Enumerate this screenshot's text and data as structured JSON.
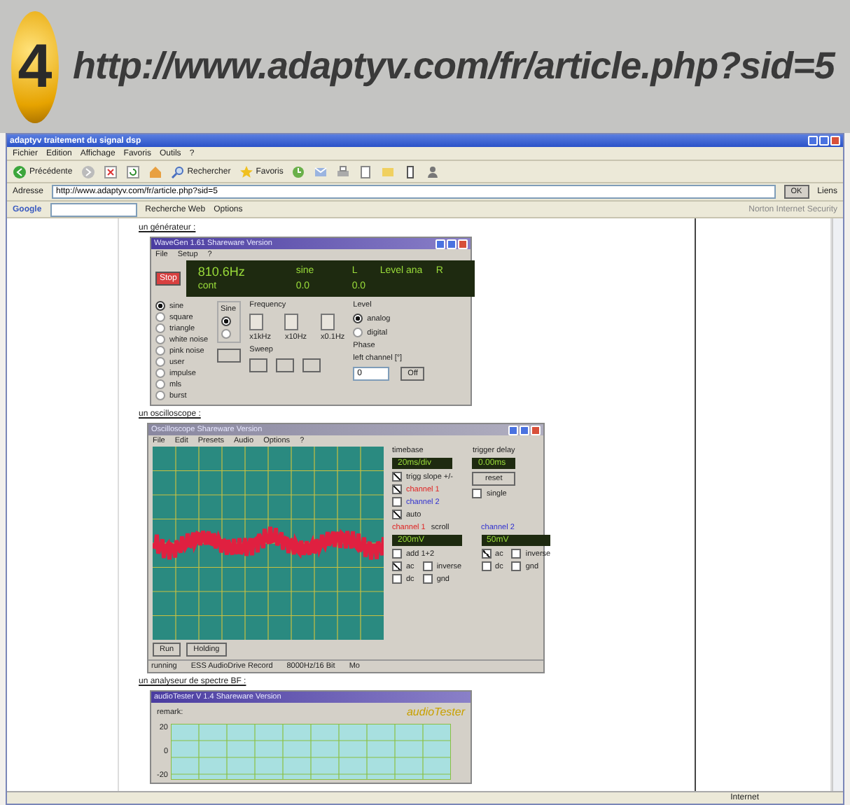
{
  "header": {
    "number": "4",
    "url": "http://www.adaptyv.com/fr/article.php?sid=5"
  },
  "browser": {
    "title": "adaptyv traitement du signal dsp",
    "menu": [
      "Fichier",
      "Edition",
      "Affichage",
      "Favoris",
      "Outils",
      "?"
    ],
    "toolbar": [
      {
        "kind": "back",
        "label": "Précédente"
      },
      {
        "kind": "forward"
      },
      {
        "kind": "stop"
      },
      {
        "kind": "refresh"
      },
      {
        "kind": "home"
      },
      {
        "kind": "search",
        "label": "Rechercher"
      },
      {
        "kind": "favorites",
        "label": "Favoris"
      },
      {
        "kind": "history"
      },
      {
        "kind": "mail"
      },
      {
        "kind": "print"
      },
      {
        "kind": "edit"
      },
      {
        "kind": "folder"
      },
      {
        "kind": "phone"
      },
      {
        "kind": "person"
      }
    ],
    "address": {
      "label": "Adresse",
      "value": "http://www.adaptyv.com/fr/article.php?sid=5",
      "go": "OK",
      "links": "Liens"
    },
    "google": {
      "logo": "Google",
      "search": "Recherche Web",
      "options": "Options",
      "security": "Norton Internet Security"
    },
    "status": "Internet"
  },
  "article": {
    "captions": [
      "un générateur :",
      "un oscilloscope :",
      "un analyseur de spectre BF :"
    ],
    "generator": {
      "title": "WaveGen 1.61 Shareware Version",
      "menu": [
        "File",
        "Setup",
        "?"
      ],
      "stop": "Stop",
      "display": [
        "810.6Hz",
        "sine",
        "L",
        "Level ana",
        "R",
        "cont",
        "0.0",
        "0.0"
      ],
      "waves": [
        {
          "label": "sine",
          "selected": true
        },
        {
          "label": "square",
          "selected": false
        },
        {
          "label": "triangle",
          "selected": false
        },
        {
          "label": "white noise",
          "selected": false
        },
        {
          "label": "pink noise",
          "selected": false
        },
        {
          "label": "user",
          "selected": false
        },
        {
          "label": "impulse",
          "selected": false
        },
        {
          "label": "mls",
          "selected": false
        },
        {
          "label": "burst",
          "selected": false
        }
      ],
      "sine_modes": [
        {
          "selected": true
        },
        {
          "selected": false
        }
      ],
      "groups": [
        "Sine",
        "Frequency",
        "Level",
        "Sweep",
        "Phase"
      ],
      "steps": [
        "x1kHz",
        "x10Hz",
        "x0.1Hz"
      ],
      "level_modes": [
        {
          "label": "analog",
          "selected": true
        },
        {
          "label": "digital",
          "selected": false
        }
      ],
      "phase_label": "left channel [°]",
      "phase_value": "0",
      "off": "Off"
    },
    "scope": {
      "title": "Oscilloscope Shareware Version",
      "menu": [
        "File",
        "Edit",
        "Presets",
        "Audio",
        "Options",
        "?"
      ],
      "timebase": {
        "label": "timebase",
        "value": "20ms/div"
      },
      "trigger": {
        "label": "trigger delay",
        "value": "0.00ms"
      },
      "reset": "reset",
      "checks": [
        {
          "label": "trigg slope +/-",
          "checked": true
        },
        {
          "label": "channel 1",
          "checked": true
        },
        {
          "label": "channel 2",
          "checked": false
        },
        {
          "label": "auto",
          "checked": true
        }
      ],
      "single": {
        "label": "single",
        "checked": false
      },
      "channels": [
        {
          "label": "channel 1",
          "value": "200mV",
          "color": "#e02020",
          "options": [
            {
              "label": "ac",
              "checked": true
            },
            {
              "label": "inverse",
              "checked": false
            },
            {
              "label": "dc",
              "checked": false
            },
            {
              "label": "gnd",
              "checked": false
            }
          ]
        },
        {
          "label": "channel 2",
          "value": "50mV",
          "color": "#3030d0",
          "options": [
            {
              "label": "ac",
              "checked": true
            },
            {
              "label": "inverse",
              "checked": false
            },
            {
              "label": "dc",
              "checked": false
            },
            {
              "label": "gnd",
              "checked": false
            }
          ]
        }
      ],
      "scroll": "scroll",
      "add": {
        "label": "add 1+2",
        "checked": false
      },
      "buttons": [
        "Run",
        "Holding"
      ],
      "status": [
        "running",
        "ESS AudioDrive Record",
        "8000Hz/16 Bit",
        "Mo"
      ]
    },
    "analyzer": {
      "title": "audioTester V 1.4 Shareware Version",
      "remark": "remark:",
      "brand": "audioTester",
      "yticks": [
        "20",
        "0",
        "-20"
      ]
    }
  }
}
